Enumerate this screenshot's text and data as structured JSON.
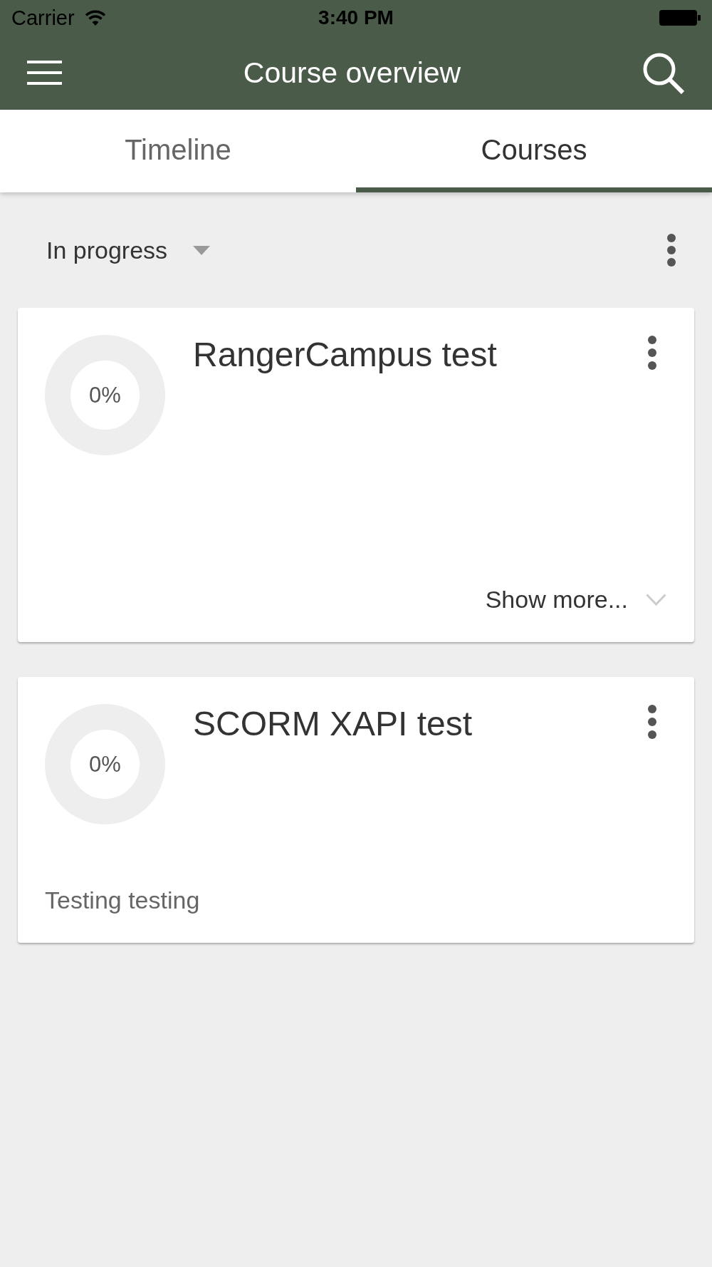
{
  "status_bar": {
    "carrier": "Carrier",
    "time": "3:40 PM"
  },
  "app_bar": {
    "title": "Course overview"
  },
  "tabs": [
    {
      "label": "Timeline",
      "selected": false
    },
    {
      "label": "Courses",
      "selected": true
    }
  ],
  "filter": {
    "label": "In progress"
  },
  "courses": [
    {
      "title": "RangerCampus test",
      "progress": "0%",
      "level": 0,
      "footer": {
        "kind": "show_more",
        "text": "Show more..."
      }
    },
    {
      "title": "SCORM XAPI test",
      "progress": "0%",
      "level": 0,
      "footer": {
        "kind": "summary",
        "text": "Testing testing"
      }
    }
  ]
}
